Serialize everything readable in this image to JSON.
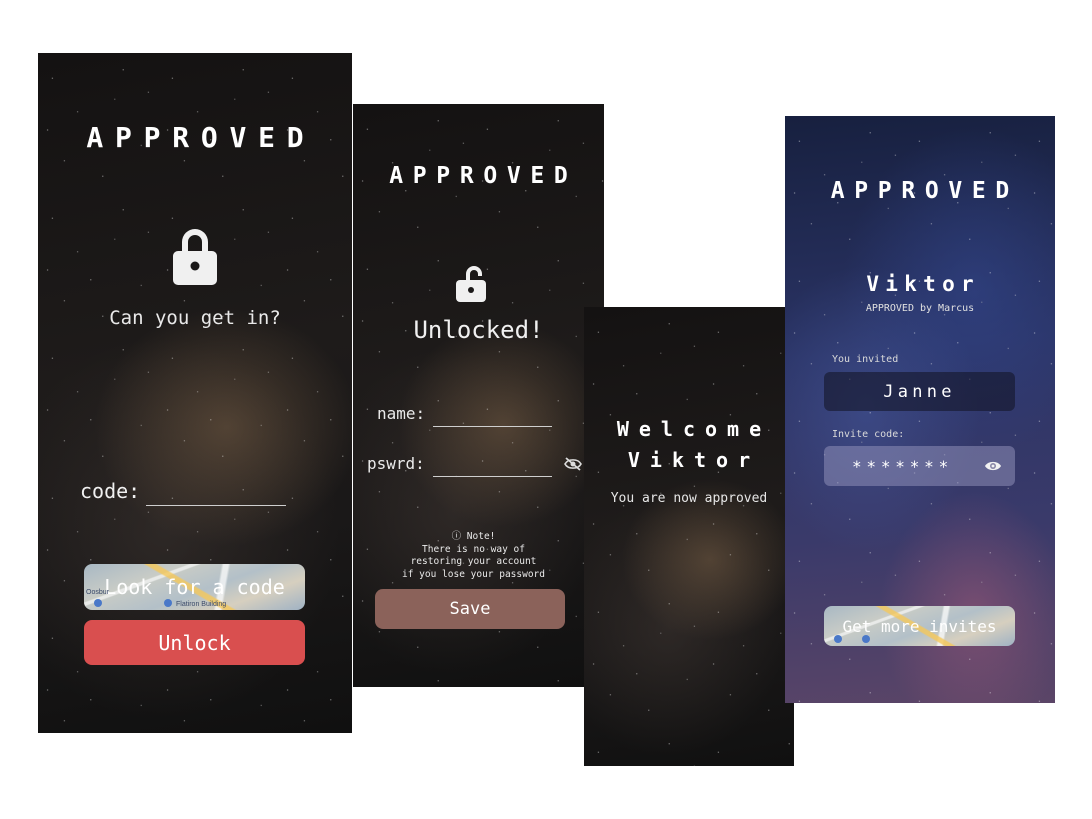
{
  "app": {
    "brand": "APPROVED"
  },
  "screen1": {
    "prompt": "Can you get in?",
    "code_label": "code:",
    "code_value": "",
    "look_button": "Look for a code",
    "unlock_button": "Unlock",
    "map_labels": [
      "Oosbur",
      "Flatiron Building"
    ],
    "colors": {
      "unlock": "#d94f4f"
    }
  },
  "screen2": {
    "title": "Unlocked!",
    "name_label": "name:",
    "name_value": "",
    "pswrd_label": "pswrd:",
    "pswrd_value": "",
    "note_title": "ⓘ Note!",
    "note_lines": [
      "There is no way of",
      "restoring your account",
      "if you lose your password"
    ],
    "save_button": "Save",
    "icons": {
      "toggle": "eye-off-icon"
    },
    "colors": {
      "save": "#8b625a"
    }
  },
  "screen3": {
    "welcome": "Welcome",
    "name": "Viktor",
    "status": "You are now approved"
  },
  "screen4": {
    "name": "Viktor",
    "approved_by": "APPROVED by Marcus",
    "invited_label": "You invited",
    "invited_value": "Janne",
    "invite_code_label": "Invite code:",
    "invite_code_value": "*******",
    "more_invites_button": "Get more invites",
    "icons": {
      "toggle": "eye-icon"
    }
  }
}
